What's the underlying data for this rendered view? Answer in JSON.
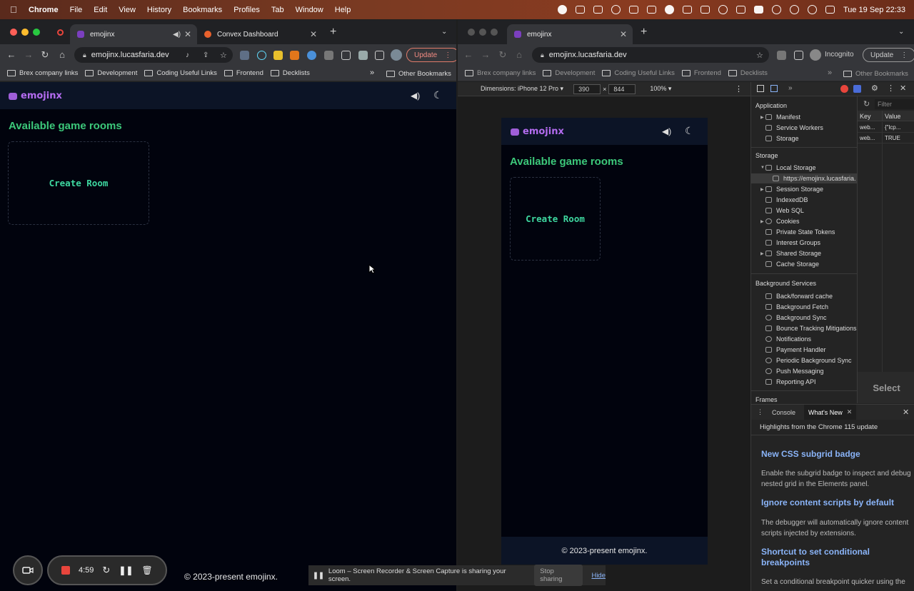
{
  "menubar": {
    "app": "Chrome",
    "items": [
      "File",
      "Edit",
      "View",
      "History",
      "Bookmarks",
      "Profiles",
      "Tab",
      "Window",
      "Help"
    ],
    "datetime": "Tue 19 Sep  22:33"
  },
  "left_window": {
    "tabs": [
      {
        "title": "emojinx"
      },
      {
        "title": "Convex Dashboard"
      }
    ],
    "url": "emojinx.lucasfaria.dev",
    "update_label": "Update",
    "bookmarks": [
      "Brex company links",
      "Development",
      "Coding Useful Links",
      "Frontend",
      "Decklists"
    ],
    "more": "»",
    "other_bookmarks": "Other Bookmarks"
  },
  "app": {
    "logo": "emojinx",
    "rooms_title": "Available game rooms",
    "create_room": "Create Room",
    "footer": "© 2023-present emojinx."
  },
  "loom": {
    "timer": "4:59",
    "share_message": "Loom – Screen Recorder & Screen Capture is sharing your screen.",
    "stop_label": "Stop sharing",
    "hide_label": "Hide"
  },
  "right_window": {
    "tab": "emojinx",
    "url": "emojinx.lucasfaria.dev",
    "profile": "Incognito",
    "update_label": "Update",
    "bookmarks": [
      "Brex company links",
      "Development",
      "Coding Useful Links",
      "Frontend",
      "Decklists"
    ],
    "more": "»",
    "other_bookmarks": "Other Bookmarks",
    "emulation": {
      "device": "Dimensions: iPhone 12 Pro ▾",
      "width": "390",
      "x": "×",
      "height": "844",
      "zoom": "100% ▾"
    }
  },
  "devtools": {
    "sections": {
      "application": "Application",
      "application_items": [
        "Manifest",
        "Service Workers",
        "Storage"
      ],
      "storage": "Storage",
      "storage_items": [
        "Local Storage",
        "https://emojinx.lucasfaria.",
        "Session Storage",
        "IndexedDB",
        "Web SQL",
        "Cookies",
        "Private State Tokens",
        "Interest Groups",
        "Shared Storage",
        "Cache Storage"
      ],
      "background": "Background Services",
      "background_items": [
        "Back/forward cache",
        "Background Fetch",
        "Background Sync",
        "Bounce Tracking Mitigations",
        "Notifications",
        "Payment Handler",
        "Periodic Background Sync",
        "Push Messaging",
        "Reporting API"
      ],
      "frames": "Frames"
    },
    "filter_placeholder": "Filter",
    "table": {
      "headers": [
        "Key",
        "Value"
      ],
      "rows": [
        [
          "web...",
          "{\"lcp..."
        ],
        [
          "web...",
          "TRUE"
        ]
      ]
    },
    "select_hint": "Select",
    "drawer_tabs": [
      "Console",
      "What's New"
    ],
    "whats_new": {
      "intro": "Highlights from the Chrome 115 update",
      "items": [
        {
          "title": "New CSS subgrid badge",
          "body": "Enable the subgrid badge to inspect and debug nested grid in the Elements panel."
        },
        {
          "title": "Ignore content scripts by default",
          "body": "The debugger will automatically ignore content scripts injected by extensions."
        },
        {
          "title": "Shortcut to set conditional breakpoints",
          "body": "Set a conditional breakpoint quicker using the"
        }
      ]
    }
  }
}
